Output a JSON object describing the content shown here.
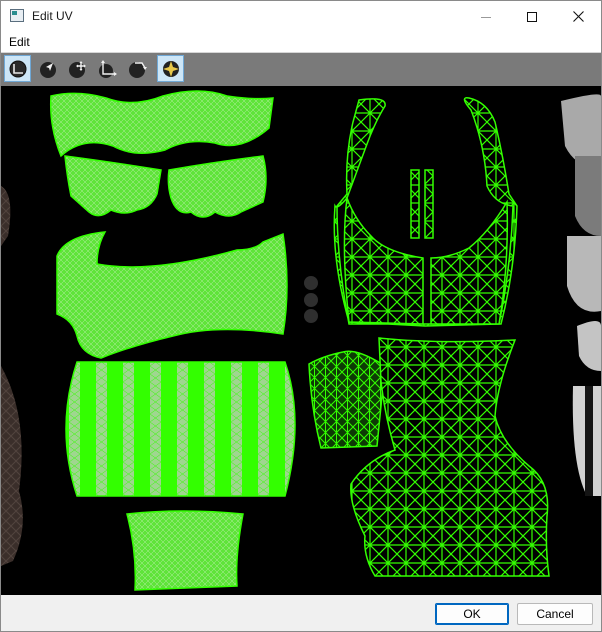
{
  "window": {
    "title": "Edit UV"
  },
  "menu": {
    "items": [
      "Edit"
    ]
  },
  "toolbar": {
    "tools": [
      {
        "icon": "select-region-icon",
        "active": true
      },
      {
        "icon": "pointer-arrow-icon",
        "active": false
      },
      {
        "icon": "move-vertices-icon",
        "active": false
      },
      {
        "icon": "scale-icon",
        "active": false
      },
      {
        "icon": "rotate-icon",
        "active": false
      },
      {
        "icon": "transform-gizmo-icon",
        "active": true
      }
    ]
  },
  "canvas": {
    "background": "#000000",
    "wireframe_color": "#33ff00"
  },
  "footer": {
    "ok_label": "OK",
    "cancel_label": "Cancel"
  }
}
